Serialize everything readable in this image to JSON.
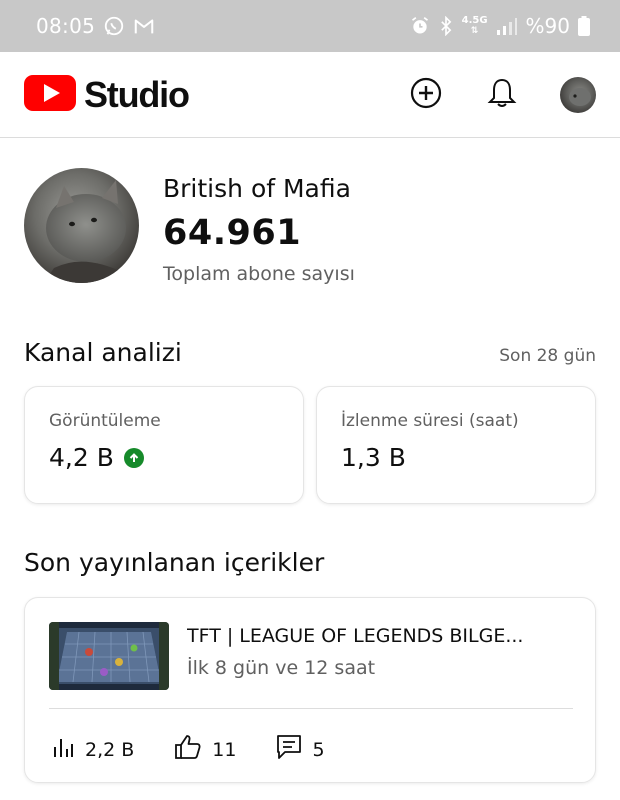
{
  "status_bar": {
    "time": "08:05",
    "left_icons": [
      "whatsapp-icon",
      "gmail-icon"
    ],
    "right_icons": [
      "alarm-icon",
      "bluetooth-icon",
      "network-4-5g-icon",
      "signal-icon"
    ],
    "network_label": "4.5G",
    "battery_text": "%90"
  },
  "app_bar": {
    "logo_text": "Studio",
    "brand_color": "#ff0000",
    "actions": [
      "create-icon",
      "notifications-icon",
      "account-avatar"
    ]
  },
  "channel": {
    "name": "British of Mafia",
    "subscriber_count": "64.961",
    "subscriber_label": "Toplam abone sayısı"
  },
  "analytics": {
    "title": "Kanal analizi",
    "period": "Son 28 gün",
    "cards": [
      {
        "label": "Görüntüleme",
        "value": "4,2 B",
        "trend": "up",
        "trend_color": "#168a2a"
      },
      {
        "label": "İzlenme süresi (saat)",
        "value": "1,3 B"
      }
    ]
  },
  "recent": {
    "title": "Son yayınlanan içerikler",
    "video": {
      "title": "TFT | LEAGUE OF LEGENDS BILGE...",
      "age": "İlk 8 gün ve 12 saat",
      "views": "2,2 B",
      "likes": "11",
      "comments": "5"
    }
  }
}
